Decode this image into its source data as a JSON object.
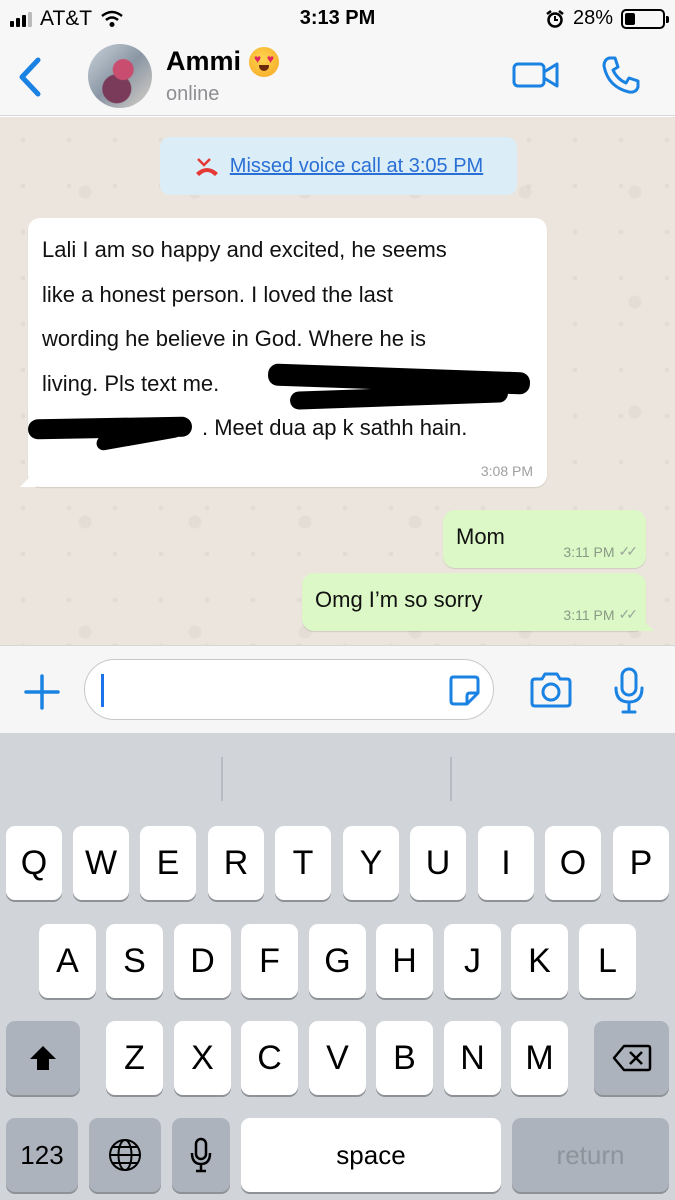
{
  "status_bar": {
    "carrier": "AT&T",
    "time": "3:13 PM",
    "battery": "28%",
    "battery_level": 0.28
  },
  "header": {
    "back_icon": "chevron-left-icon",
    "name": "Ammi",
    "status": "online",
    "video_icon": "video-camera-icon",
    "call_icon": "phone-icon"
  },
  "chat": {
    "missed_call": "Missed voice call at 3:05 PM",
    "incoming": {
      "lines": [
        "Lali I am so happy and excited, he seems",
        "like a honest person. I loved the last",
        "wording he believe in God. Where he is",
        "living. Pls text me.",
        ". Meet dua ap k sathh hain."
      ],
      "time": "3:08 PM"
    },
    "outgoing": [
      {
        "text": "Mom",
        "time": "3:11 PM"
      },
      {
        "text": "Omg I’m so sorry",
        "time": "3:11 PM"
      }
    ]
  },
  "input": {
    "value": "",
    "plus_icon": "plus-icon",
    "sticker_icon": "sticker-icon",
    "camera_icon": "camera-icon",
    "mic_icon": "microphone-icon"
  },
  "keyboard": {
    "row1": [
      "Q",
      "W",
      "E",
      "R",
      "T",
      "Y",
      "U",
      "I",
      "O",
      "P"
    ],
    "row2": [
      "A",
      "S",
      "D",
      "F",
      "G",
      "H",
      "J",
      "K",
      "L"
    ],
    "row3": [
      "Z",
      "X",
      "C",
      "V",
      "B",
      "N",
      "M"
    ],
    "numbers": "123",
    "space": "space",
    "return": "return"
  },
  "colors": {
    "accent": "#1a82e2",
    "outgoing_bubble": "#dcf8c6",
    "chat_background": "#ece5dd",
    "missed_call_bg": "#dbeef7"
  }
}
